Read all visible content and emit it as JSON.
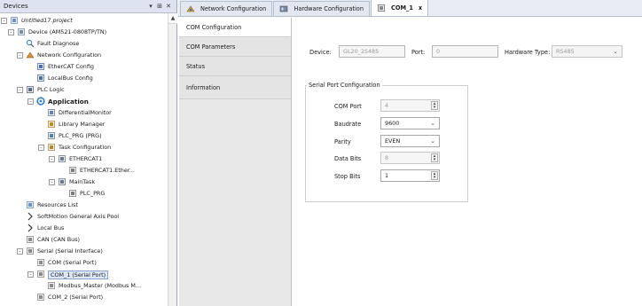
{
  "devices_panel": {
    "title": "Devices",
    "pin": "▾",
    "dock": "⊞",
    "close": "✕",
    "tree": [
      {
        "label": "Untitled17.project",
        "icon": "project-icon",
        "expander": "-"
      },
      {
        "label": "Device (AM521-0808TP/TN)",
        "icon": "device-icon",
        "expander": "-"
      },
      {
        "label": "Fault Diagnose",
        "icon": "diagnose-icon",
        "expander": ""
      },
      {
        "label": "Network Configuration",
        "icon": "network-icon",
        "expander": "-"
      },
      {
        "label": "EtherCAT Config",
        "icon": "ethercat-config-icon",
        "expander": ""
      },
      {
        "label": "LocalBus Config",
        "icon": "localbus-config-icon",
        "expander": ""
      },
      {
        "label": "PLC Logic",
        "icon": "plc-logic-icon",
        "expander": "-"
      },
      {
        "label": "Application",
        "icon": "application-icon",
        "expander": "-"
      },
      {
        "label": "DifferentialMonitor",
        "icon": "monitor-icon",
        "expander": ""
      },
      {
        "label": "Library Manager",
        "icon": "library-icon",
        "expander": ""
      },
      {
        "label": "PLC_PRG (PRG)",
        "icon": "program-icon",
        "expander": ""
      },
      {
        "label": "Task Configuration",
        "icon": "task-config-icon",
        "expander": "-"
      },
      {
        "label": "ETHERCAT1",
        "icon": "task-icon",
        "expander": "-"
      },
      {
        "label": "ETHERCAT1.Ether...",
        "icon": "program-call-icon",
        "expander": ""
      },
      {
        "label": "MainTask",
        "icon": "task-icon",
        "expander": "-"
      },
      {
        "label": "PLC_PRG",
        "icon": "program-call-icon",
        "expander": ""
      },
      {
        "label": "Resources List",
        "icon": "resources-icon",
        "expander": ""
      },
      {
        "label": "SoftMotion General Axis Pool",
        "icon": "axis-pool-icon",
        "expander": ""
      },
      {
        "label": "Local Bus",
        "icon": "local-bus-icon",
        "expander": ""
      },
      {
        "label": "CAN (CAN Bus)",
        "icon": "can-bus-icon",
        "expander": ""
      },
      {
        "label": "Serial (Serial Interface)",
        "icon": "serial-interface-icon",
        "expander": "-"
      },
      {
        "label": "COM (Serial Port)",
        "icon": "serial-port-icon",
        "expander": ""
      },
      {
        "label": "COM_1 (Serial Port)",
        "icon": "serial-port-icon",
        "expander": "-"
      },
      {
        "label": "Modbus_Master (Modbus M...",
        "icon": "modbus-icon",
        "expander": ""
      },
      {
        "label": "COM_2 (Serial Port)",
        "icon": "serial-port-icon",
        "expander": ""
      }
    ]
  },
  "tabs": [
    {
      "label": "Network Configuration",
      "icon": "network-icon"
    },
    {
      "label": "Hardware Configuration",
      "icon": "hardware-icon"
    },
    {
      "label": "COM_1",
      "icon": "serial-port-icon",
      "close": "x"
    }
  ],
  "side_nav": [
    "COM Configuration",
    "COM Parameters",
    "Status",
    "Information"
  ],
  "device_row": {
    "device_label": "Device:",
    "device_value": "GL20_2S485",
    "port_label": "Port:",
    "port_value": "0",
    "hwtype_label": "Hardware Type:",
    "hwtype_value": "RS485"
  },
  "serial_group": {
    "title": "Serial Port Configuration",
    "com_port_label": "COM Port",
    "com_port_value": "4",
    "baudrate_label": "Baudrate",
    "baudrate_value": "9600",
    "parity_label": "Parity",
    "parity_value": "EVEN",
    "databits_label": "Data Bits",
    "databits_value": "8",
    "stopbits_label": "Stop Bits",
    "stopbits_value": "1"
  },
  "colors": {
    "header_bg": "#dde4ef",
    "selection_bg": "#dce8f8",
    "nav_bg": "#e8e8e8"
  }
}
